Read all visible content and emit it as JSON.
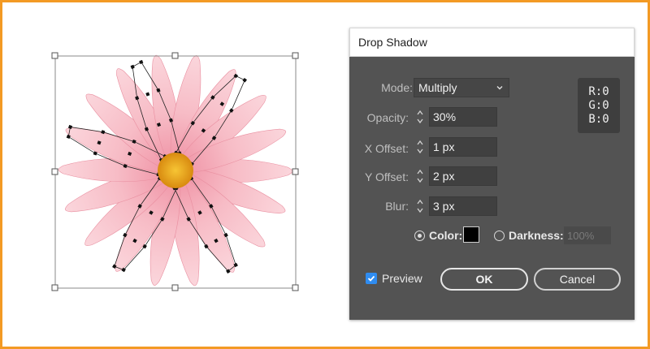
{
  "dialog": {
    "title": "Drop Shadow",
    "mode": {
      "label": "Mode:",
      "value": "Multiply"
    },
    "opacity": {
      "label": "Opacity:",
      "value": "30%"
    },
    "x_offset": {
      "label": "X Offset:",
      "value": "1 px"
    },
    "y_offset": {
      "label": "Y Offset:",
      "value": "2 px"
    },
    "blur": {
      "label": "Blur:",
      "value": "3 px"
    },
    "rgb": {
      "r": "R:0",
      "g": "G:0",
      "b": "B:0"
    },
    "color_option": {
      "label": "Color:",
      "selected": true,
      "swatch": "#000000"
    },
    "darkness_option": {
      "label": "Darkness:",
      "value": "100%",
      "selected": false
    },
    "preview": {
      "label": "Preview",
      "checked": true
    },
    "ok_label": "OK",
    "cancel_label": "Cancel"
  },
  "colors": {
    "accent_frame": "#f39a24",
    "dialog_bg": "#535353",
    "petal": "#f4a6b4",
    "flower_center": "#f2b21c",
    "checkbox": "#2f8cf0"
  }
}
